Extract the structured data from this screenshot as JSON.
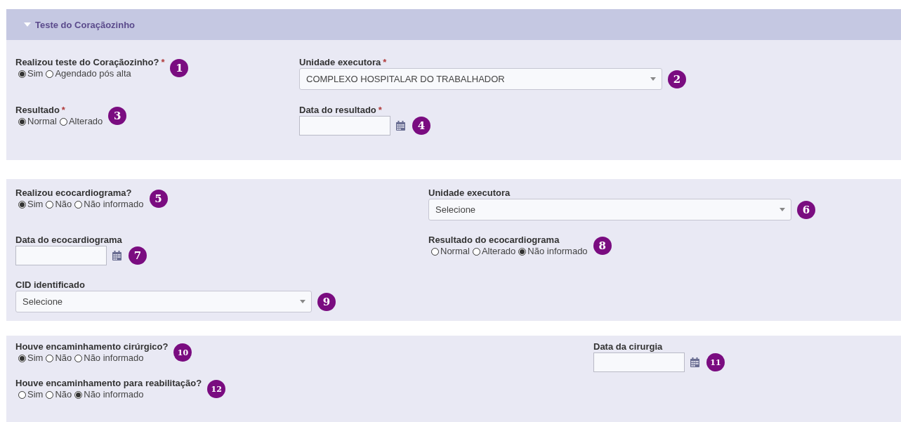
{
  "section": {
    "title": "Teste do Coraçãozinho",
    "expanded": true
  },
  "panels": [
    {
      "fields": [
        {
          "kind": "radio",
          "label": "Realizou teste do Coraçãozinho?",
          "required_mark": "*",
          "badge": "1",
          "options": [
            {
              "label": "Sim",
              "selected": true
            },
            {
              "label": "Agendado pós alta",
              "selected": false
            }
          ]
        },
        {
          "kind": "select",
          "label": "Unidade executora",
          "required_mark": "*",
          "badge": "2",
          "value": "COMPLEXO HOSPITALAR DO TRABALHADOR"
        },
        {
          "kind": "radio",
          "label": "Resultado",
          "required_mark": "*",
          "badge": "3",
          "options": [
            {
              "label": "Normal",
              "selected": true
            },
            {
              "label": "Alterado",
              "selected": false
            }
          ]
        },
        {
          "kind": "date",
          "label": "Data do resultado",
          "required_mark": "*",
          "badge": "4"
        }
      ]
    },
    {
      "fields": [
        {
          "kind": "radio",
          "label": "Realizou ecocardiograma?",
          "badge": "5",
          "options": [
            {
              "label": "Sim",
              "selected": true
            },
            {
              "label": "Não",
              "selected": false
            },
            {
              "label": "Não informado",
              "selected": false
            }
          ]
        },
        {
          "kind": "select",
          "label": "Unidade executora",
          "badge": "6",
          "value": "Selecione"
        },
        {
          "kind": "date",
          "label": "Data do ecocardiograma",
          "badge": "7"
        },
        {
          "kind": "radio",
          "label": "Resultado do ecocardiograma",
          "badge": "8",
          "options": [
            {
              "label": "Normal",
              "selected": false
            },
            {
              "label": "Alterado",
              "selected": false
            },
            {
              "label": "Não informado",
              "selected": true
            }
          ]
        },
        {
          "kind": "select",
          "label": "CID identificado",
          "badge": "9",
          "value": "Selecione"
        }
      ]
    },
    {
      "fields": [
        {
          "kind": "radio",
          "label": "Houve encaminhamento cirúrgico?",
          "badge": "10",
          "options": [
            {
              "label": "Sim",
              "selected": true
            },
            {
              "label": "Não",
              "selected": false
            },
            {
              "label": "Não informado",
              "selected": false
            }
          ]
        },
        {
          "kind": "date",
          "label": "Data da cirurgia",
          "badge": "11"
        },
        {
          "kind": "radio",
          "label": "Houve encaminhamento para reabilitação?",
          "badge": "12",
          "options": [
            {
              "label": "Sim",
              "selected": false
            },
            {
              "label": "Não",
              "selected": false
            },
            {
              "label": "Não informado",
              "selected": true
            }
          ]
        }
      ]
    }
  ]
}
